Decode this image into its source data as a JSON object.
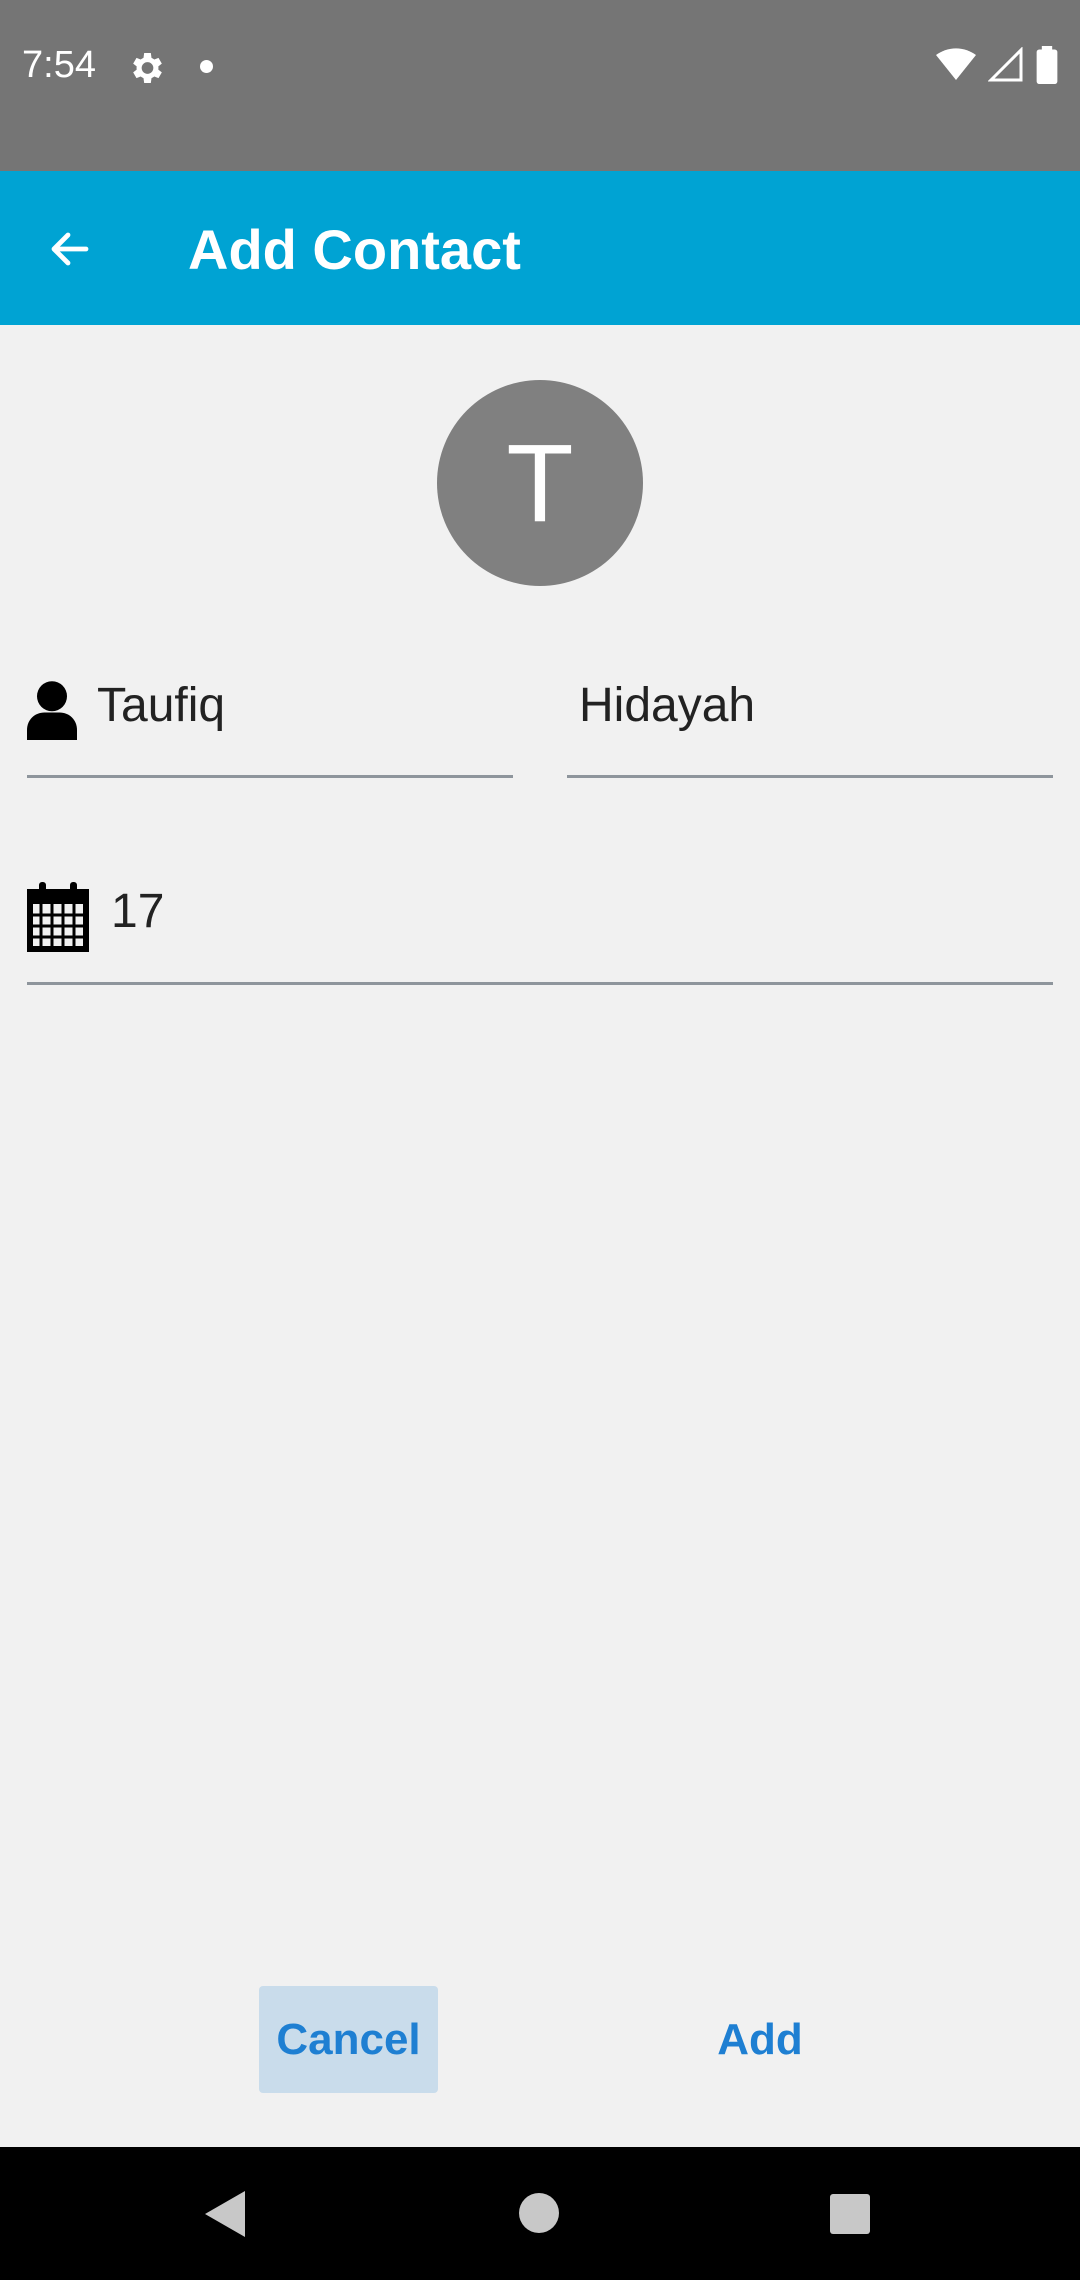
{
  "status_bar": {
    "time": "7:54",
    "icons": [
      "gear-icon",
      "notification-dot-icon",
      "wifi-icon",
      "signal-icon",
      "battery-icon"
    ]
  },
  "app_bar": {
    "title": "Add Contact",
    "back_icon": "arrow-back-icon",
    "background": "#00a3d3"
  },
  "avatar": {
    "initial": "T",
    "color": "#808080"
  },
  "form": {
    "first_name": "Taufiq",
    "last_name": "Hidayah",
    "birthday": "17",
    "first_name_icon": "person-icon",
    "birthday_icon": "calendar-icon"
  },
  "actions": {
    "cancel_label": "Cancel",
    "add_label": "Add",
    "accent": "#1e7fd2"
  },
  "nav_bar": {
    "icons": [
      "nav-back-icon",
      "nav-home-icon",
      "nav-recents-icon"
    ]
  }
}
